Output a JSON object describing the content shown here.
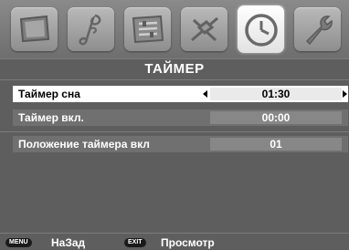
{
  "tabs": [
    {
      "icon": "screen-icon",
      "active": false
    },
    {
      "icon": "music-note-icon",
      "active": false
    },
    {
      "icon": "settings-panel-icon",
      "active": false
    },
    {
      "icon": "satellite-icon",
      "active": false
    },
    {
      "icon": "clock-icon",
      "active": true
    },
    {
      "icon": "wrench-icon",
      "active": false
    }
  ],
  "title": "ТАЙМЕР",
  "rows": [
    {
      "label": "Таймер сна",
      "value": "01:30",
      "selected": true
    },
    {
      "label": "Таймер вкл.",
      "value": "00:00",
      "selected": false
    },
    {
      "label": "Положение таймера вкл",
      "value": "01",
      "selected": false
    }
  ],
  "footer": {
    "back_key": "MENU",
    "back_label": "НаЗад",
    "exit_key": "EXIT",
    "exit_label": "Просмотр"
  },
  "colors": {
    "background": "#5e5e5e",
    "row": "#707070",
    "selected_row": "#ffffff",
    "value_box": "#878787"
  }
}
